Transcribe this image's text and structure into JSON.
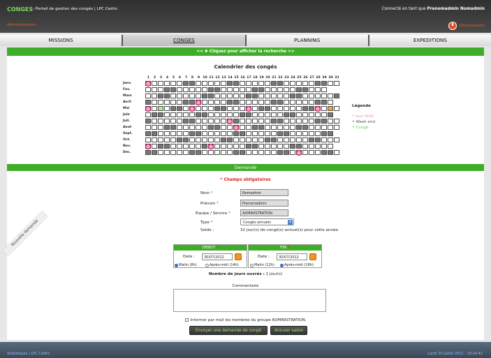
{
  "header": {
    "logo": "CONGES",
    "app_title": "- Portail de gestion des congés | LPC Cedric",
    "admin_link": "Administration",
    "connected_prefix": "Connecté en tant que",
    "connected_user": "Prenomadmin Nomadmin",
    "logout_label": "Déconnexion",
    "logout_icon": "power-icon"
  },
  "nav": {
    "tabs": [
      {
        "label": "MISSIONS"
      },
      {
        "label": "CONGES"
      },
      {
        "label": "PLANNING"
      },
      {
        "label": "EXPEDITIONS"
      }
    ]
  },
  "search_bar": {
    "label": "<< ✱ Cliquez pour afficher la recherche >>"
  },
  "calendar": {
    "title": "Calendrier des congés",
    "days": [
      "1",
      "2",
      "3",
      "4",
      "5",
      "6",
      "7",
      "8",
      "9",
      "10",
      "11",
      "12",
      "13",
      "14",
      "15",
      "16",
      "17",
      "18",
      "19",
      "20",
      "21",
      "22",
      "23",
      "24",
      "25",
      "26",
      "27",
      "28",
      "29",
      "30",
      "31"
    ],
    "months": [
      "Janv.",
      "Fev.",
      "Mars",
      "Avril",
      "Mai",
      "Juin",
      "Juil.",
      "Aout",
      "Sept.",
      "Oct.",
      "Nov.",
      "Dec."
    ],
    "month_lengths": [
      31,
      29,
      31,
      30,
      31,
      30,
      31,
      31,
      30,
      31,
      30,
      31
    ],
    "first_weekday": [
      6,
      2,
      3,
      6,
      1,
      4,
      6,
      2,
      5,
      0,
      3,
      5
    ],
    "holidays": [
      [
        0,
        0
      ],
      [
        4,
        0
      ],
      [
        4,
        7
      ],
      [
        4,
        16
      ],
      [
        6,
        13
      ],
      [
        7,
        14
      ],
      [
        10,
        0
      ],
      [
        10,
        10
      ],
      [
        11,
        24
      ],
      [
        4,
        27
      ],
      [
        3,
        8
      ]
    ],
    "conge": [
      [
        4,
        2
      ]
    ],
    "special": [
      [
        4,
        29
      ]
    ],
    "colors": {
      "weekend": "#777777",
      "ferie": "#f4a8bf",
      "conge": "#b5e8a0",
      "special": "#f4a24a",
      "green": "#3fad27"
    }
  },
  "legend": {
    "title": "Légende",
    "items": [
      {
        "label": "Jour férié",
        "color": "#f48fb1"
      },
      {
        "label": "Week end",
        "color": "#555555"
      },
      {
        "label": "Congé",
        "color": "#66cc44"
      }
    ]
  },
  "demande": {
    "bar_label": "Demande",
    "ribbon": "Nouvelle demande",
    "required_note": "* Champs obligatoires",
    "nom_label": "Nom",
    "nom_value": "Nomadmin",
    "prenom_label": "Prénom",
    "prenom_value": "Prenomadmin",
    "equipe_label": "Equipe / Service",
    "equipe_value": "ADMINISTRATION",
    "type_label": "Type",
    "type_value": "Congés annuels",
    "solde_label": "Solde :",
    "solde_value": "32 jour(s) de congé(s) annuel(s) pour cette année.",
    "star": "*"
  },
  "periode": {
    "debut_label": "DEBUT",
    "fin_label": "FIN",
    "date_label": "Date :",
    "debut_date": "30/07/2012",
    "fin_date": "30/07/2012",
    "debut_opt1": "Matin (8h)",
    "debut_opt2": "Après-midi (14h)",
    "fin_opt1": "Matin (12h)",
    "fin_opt2": "Après-midi (18h)",
    "jours_label": "Nombre de jours ouvrés :",
    "jours_value": "1 jour(s)"
  },
  "comment": {
    "label": "Commentaire",
    "inform_label": "Informer par mail les membres du groupe ADMINISTRATION."
  },
  "buttons": {
    "submit": "Envoyer une demande de congé",
    "cancel": "Annuler saisie"
  },
  "footer": {
    "links": "Statistiques | LPC Cedric",
    "date": "Lundi 30 Juillet 2012 - 10:14:42"
  }
}
